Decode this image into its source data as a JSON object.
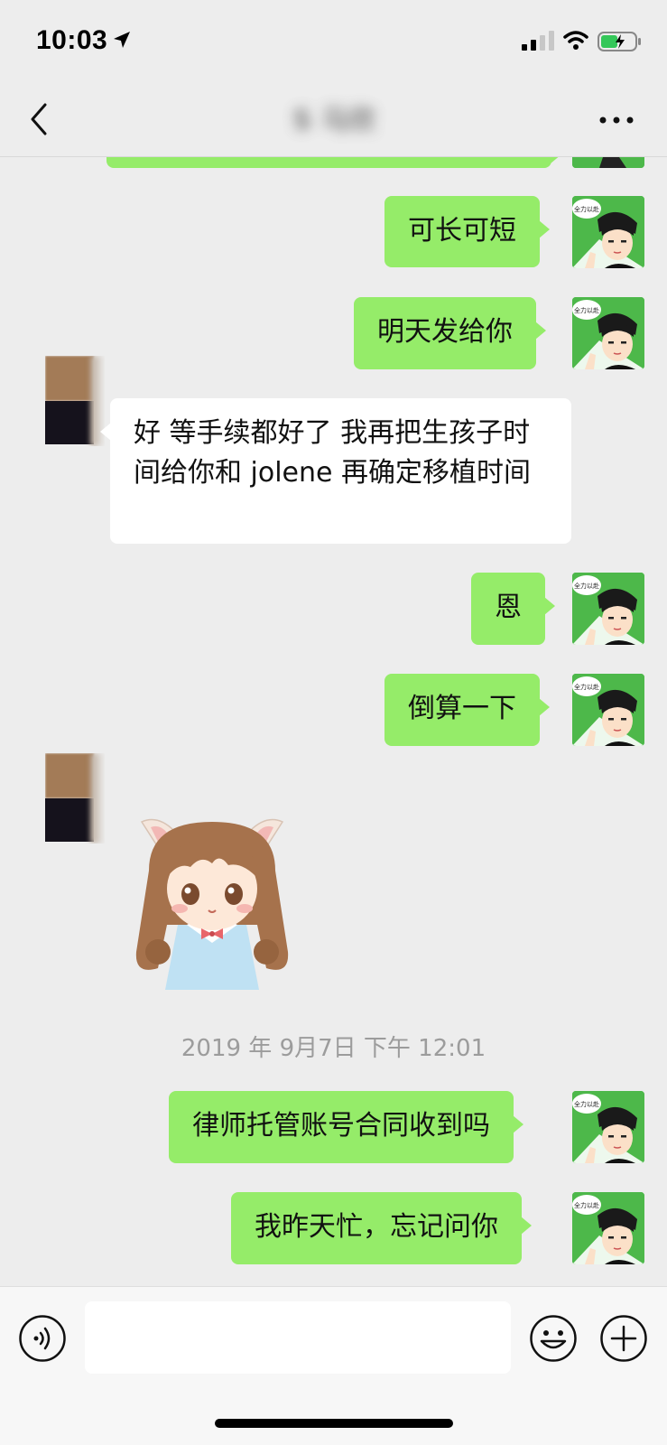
{
  "status_bar": {
    "time": "10:03"
  },
  "header": {
    "title": "S   马欣"
  },
  "messages": [
    {
      "side": "me",
      "text": "可长可短"
    },
    {
      "side": "me",
      "text": "明天发给你"
    },
    {
      "side": "them",
      "text": "好 等手续都好了 我再把生孩子时间给你和 jolene 再确定移植时间"
    },
    {
      "side": "me",
      "text": "恩"
    },
    {
      "side": "me",
      "text": "倒算一下"
    },
    {
      "side": "them",
      "type": "sticker"
    },
    {
      "side": "me",
      "text": "律师托管账号合同收到吗"
    },
    {
      "side": "me",
      "text": "我昨天忙，忘记问你"
    }
  ],
  "timestamp": "2019 年 9月7日 下午 12:01",
  "avatar_me_caption": "全力以赴",
  "input": {
    "value": ""
  },
  "colors": {
    "my_bubble": "#95ec69",
    "their_bubble": "#ffffff",
    "background": "#ededed"
  },
  "icons": [
    "location-arrow-icon",
    "signal-icon",
    "wifi-icon",
    "battery-icon",
    "back-chevron-icon",
    "more-dots-icon",
    "voice-icon",
    "emoji-icon",
    "plus-icon"
  ]
}
